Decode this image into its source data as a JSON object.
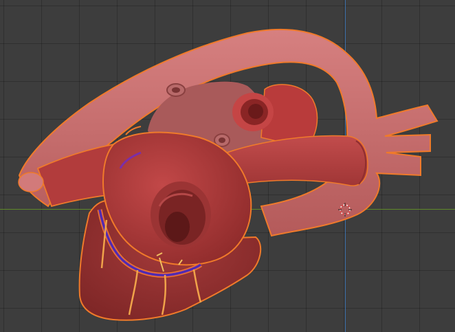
{
  "viewport": {
    "name": "3D Viewport",
    "background": "#3d3d3d",
    "x_axis_color": "#5f8a2a",
    "y_axis_color": "#3b6ea8",
    "selection_outline_color": "#f07a2a"
  },
  "model": {
    "name": "heart",
    "selected": true,
    "base_color": "#b94545",
    "vessel_colors": [
      "#d37070",
      "#b53737",
      "#7b2ea8"
    ]
  },
  "cursor": {
    "icon": "3d-cursor-icon"
  }
}
